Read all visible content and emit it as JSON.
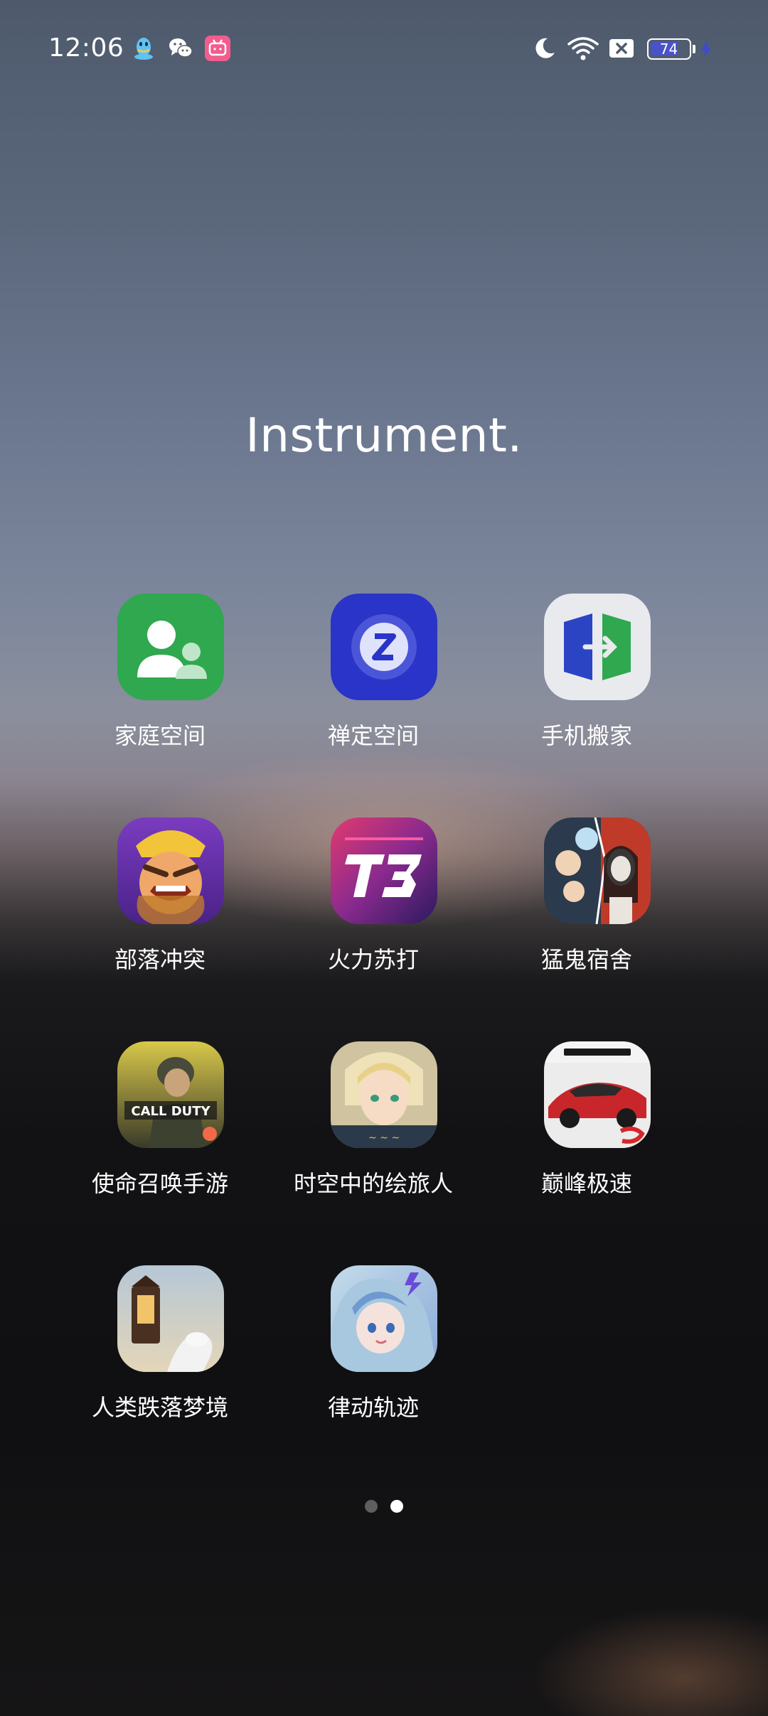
{
  "status_bar": {
    "time": "12:06",
    "left_icons": [
      "qq-icon",
      "wechat-icon",
      "bilibili-icon"
    ],
    "right_icons": [
      "moon-icon",
      "wifi-icon",
      "sim-x-icon",
      "battery-icon",
      "charging-icon"
    ],
    "battery_level": "74",
    "battery_fraction": 0.74
  },
  "folder": {
    "title": "Instrument.",
    "apps": [
      {
        "label": "家庭空间",
        "icon": "family-space-icon",
        "color": "#2fa84f"
      },
      {
        "label": "禅定空间",
        "icon": "zen-space-icon",
        "color": "#2a34c8"
      },
      {
        "label": "手机搬家",
        "icon": "phone-clone-icon",
        "color": "#e9eaed"
      },
      {
        "label": "部落冲突",
        "icon": "clash-of-clans-icon",
        "color": "#6a3bb0"
      },
      {
        "label": "火力苏打",
        "icon": "t3-icon",
        "color": "#c42a6e"
      },
      {
        "label": "猛鬼宿舍",
        "icon": "ghost-dorm-icon",
        "color": "#2b3a4c"
      },
      {
        "label": "使命召唤手游",
        "icon": "call-of-duty-icon",
        "color": "#5a5a3a"
      },
      {
        "label": "时空中的绘旅人",
        "icon": "painter-traveler-icon",
        "color": "#d8c9a0"
      },
      {
        "label": "巅峰极速",
        "icon": "racing-master-icon",
        "color": "#e9e9e9"
      },
      {
        "label": "人类跌落梦境",
        "icon": "human-fall-flat-icon",
        "color": "#9bb0c4"
      },
      {
        "label": "律动轨迹",
        "icon": "rhythm-track-icon",
        "color": "#a9c4dc"
      }
    ]
  },
  "pagination": {
    "pages": 2,
    "current": 2
  }
}
